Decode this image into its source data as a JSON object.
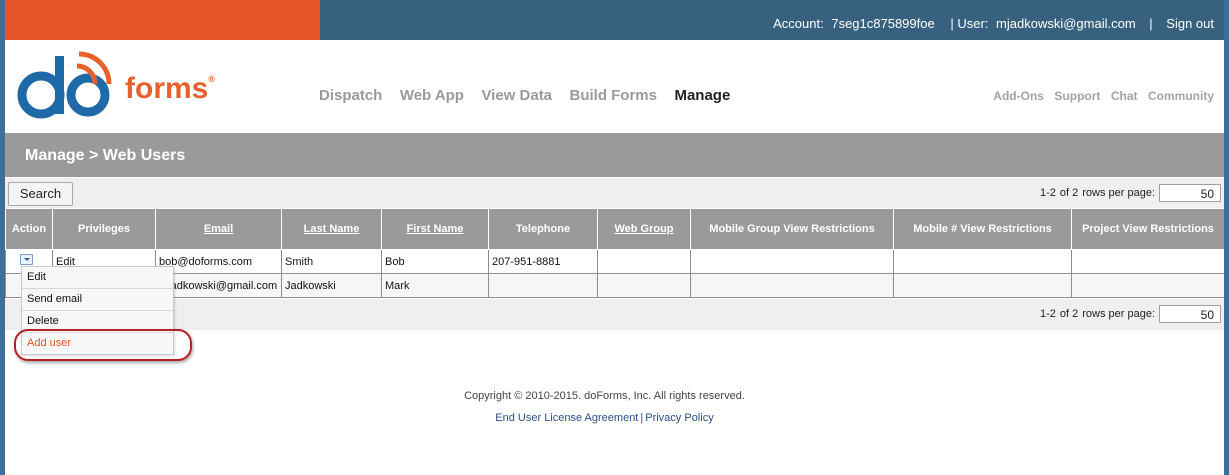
{
  "header": {
    "account_label": "Account:",
    "account_value": "7seg1c875899foe",
    "user_label": "| User:",
    "user_value": "mjadkowski@gmail.com",
    "separator": "|",
    "sign_out": "Sign out"
  },
  "logo": {
    "text": "forms",
    "registered": "®"
  },
  "nav": {
    "main": [
      "Dispatch",
      "Web App",
      "View Data",
      "Build Forms",
      "Manage"
    ],
    "active": "Manage",
    "secondary": [
      "Add-Ons",
      "Support",
      "Chat",
      "Community"
    ]
  },
  "page": {
    "title": "Manage > Web Users"
  },
  "toolbar": {
    "search_label": "Search",
    "pager_range": "1-2",
    "pager_of": "of 2",
    "rows_per_page_label": "rows per page:",
    "rows_per_page_value": "50"
  },
  "table": {
    "columns": [
      "Action",
      "Privileges",
      "Email",
      "Last Name",
      "First Name",
      "Telephone",
      "Web Group",
      "Mobile Group View Restrictions",
      "Mobile # View Restrictions",
      "Project View Restrictions"
    ],
    "rows": [
      {
        "privileges": "Edit",
        "email": "bob@doforms.com",
        "last": "Smith",
        "first": "Bob",
        "phone": "207-951-8881"
      },
      {
        "privileges": "",
        "email": "mjadkowski@gmail.com",
        "last": "Jadkowski",
        "first": "Mark",
        "phone": ""
      }
    ]
  },
  "menu": {
    "items": [
      "Edit",
      "Send email",
      "Delete",
      "Add user"
    ]
  },
  "footer": {
    "copyright": "Copyright © 2010-2015. doForms, Inc. All rights reserved.",
    "eula": "End User License Agreement",
    "link_sep": "|",
    "privacy": "Privacy Policy"
  },
  "colors": {
    "orange": "#e6562a",
    "top_bar": "#37617f",
    "header_gray": "#9a9a9a",
    "logo_blue": "#1e6aa8",
    "menu_highlight": "#b42020"
  }
}
